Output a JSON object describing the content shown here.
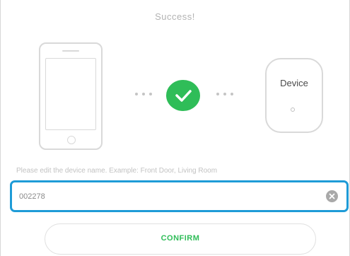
{
  "header": {
    "title": "Success!"
  },
  "illustration": {
    "phone_icon": "smartphone-icon",
    "check_icon": "check-icon",
    "device_label": "Device",
    "success_color": "#2fbd58"
  },
  "form": {
    "hint": "Please edit the device name. Example: Front Door, Living Room",
    "device_name_value": "002278",
    "clear_icon": "clear-icon",
    "focus_color": "#1e9bd7"
  },
  "actions": {
    "confirm_label": "CONFIRM"
  }
}
